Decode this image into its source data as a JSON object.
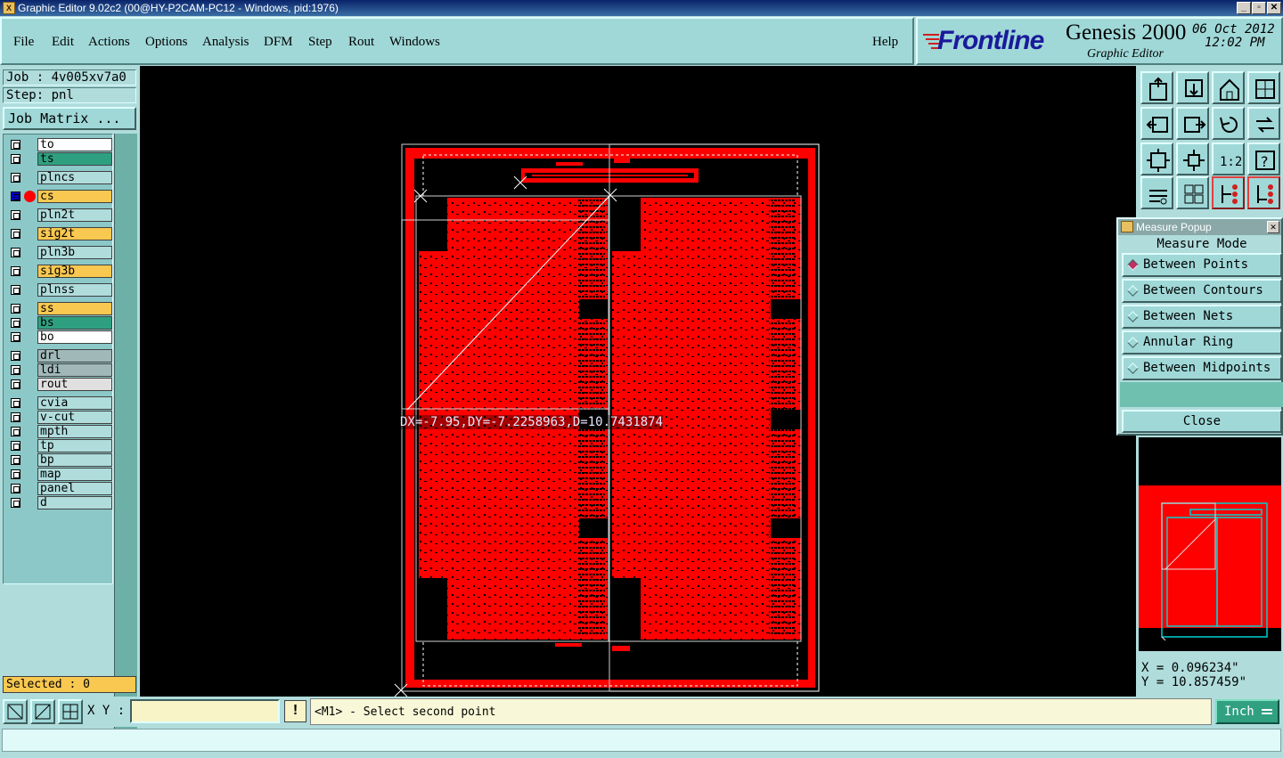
{
  "window": {
    "title": "Graphic Editor 9.02c2 (00@HY-P2CAM-PC12 - Windows, pid:1976)",
    "min_glyph": "_",
    "max_glyph": "▫",
    "close_glyph": "✕"
  },
  "menu": {
    "items": [
      "File",
      "Edit",
      "Actions",
      "Options",
      "Analysis",
      "DFM",
      "Step",
      "Rout",
      "Windows"
    ],
    "help": "Help"
  },
  "brand": {
    "logo": "Frontline",
    "product": "Genesis 2000",
    "subtitle": "Graphic Editor",
    "date": "06 Oct 2012",
    "time": "12:02 PM"
  },
  "job": {
    "job_label": "Job : 4v005xv7a0",
    "step_label": "Step: pnl",
    "matrix_button": "Job Matrix ..."
  },
  "layers": [
    {
      "name": "to",
      "color": "#ffffff"
    },
    {
      "name": "ts",
      "color": "#2ea080"
    },
    {
      "name": "plncs",
      "color": "#b0dcdc"
    },
    {
      "name": "cs",
      "color": "#f8c850",
      "active": true
    },
    {
      "name": "pln2t",
      "color": "#b0dcdc"
    },
    {
      "name": "sig2t",
      "color": "#f8c850"
    },
    {
      "name": "pln3b",
      "color": "#b0dcdc"
    },
    {
      "name": "sig3b",
      "color": "#f8c850"
    },
    {
      "name": "plnss",
      "color": "#b0dcdc"
    },
    {
      "name": "ss",
      "color": "#f8c850"
    },
    {
      "name": "bs",
      "color": "#2ea080"
    },
    {
      "name": "bo",
      "color": "#ffffff"
    },
    {
      "name": "drl",
      "color": "#a0b8b8"
    },
    {
      "name": "ldi",
      "color": "#a0b8b8"
    },
    {
      "name": "rout",
      "color": "#e0e0e0"
    },
    {
      "name": "cvia",
      "color": "#b0dcdc"
    },
    {
      "name": "v-cut",
      "color": "#b0dcdc"
    },
    {
      "name": "mpth",
      "color": "#b0dcdc"
    },
    {
      "name": "tp",
      "color": "#b0dcdc"
    },
    {
      "name": "bp",
      "color": "#b0dcdc"
    },
    {
      "name": "map",
      "color": "#b0dcdc"
    },
    {
      "name": "panel",
      "color": "#b0dcdc"
    },
    {
      "name": "d",
      "color": "#b0dcdc"
    }
  ],
  "selected_label": "Selected : 0",
  "measure_readout": "DX=-7.95,DY=-7.2258963,D=10.7431874",
  "measure_popup": {
    "title": "Measure Popup",
    "mode_label": "Measure Mode",
    "options": [
      "Between Points",
      "Between Contours",
      "Between Nets",
      "Annular Ring",
      "Between Midpoints"
    ],
    "selected": "Between Points",
    "close": "Close"
  },
  "coords": {
    "x": "X =  0.096234\"",
    "y": "Y = 10.857459\""
  },
  "bottom": {
    "xy_label": "X Y :",
    "xy_value": "",
    "excl": "!",
    "prompt": "<M1> - Select second point",
    "unit": "Inch"
  },
  "colors": {
    "board_red": "#ff0000",
    "accent_teal": "#a0d8d8",
    "layer_yellow": "#f8c850"
  },
  "tool_icons": [
    "zoom-home-icon",
    "zoom-out-icon",
    "home-view-icon",
    "split-view-icon",
    "pan-left-icon",
    "pan-right-icon",
    "undo-icon",
    "redo-icon",
    "fit-icon",
    "center-icon",
    "scale-1-2-icon",
    "help-icon",
    "palette-icon",
    "grid-icon",
    "layers-red-icon",
    "layers-red2-icon"
  ]
}
